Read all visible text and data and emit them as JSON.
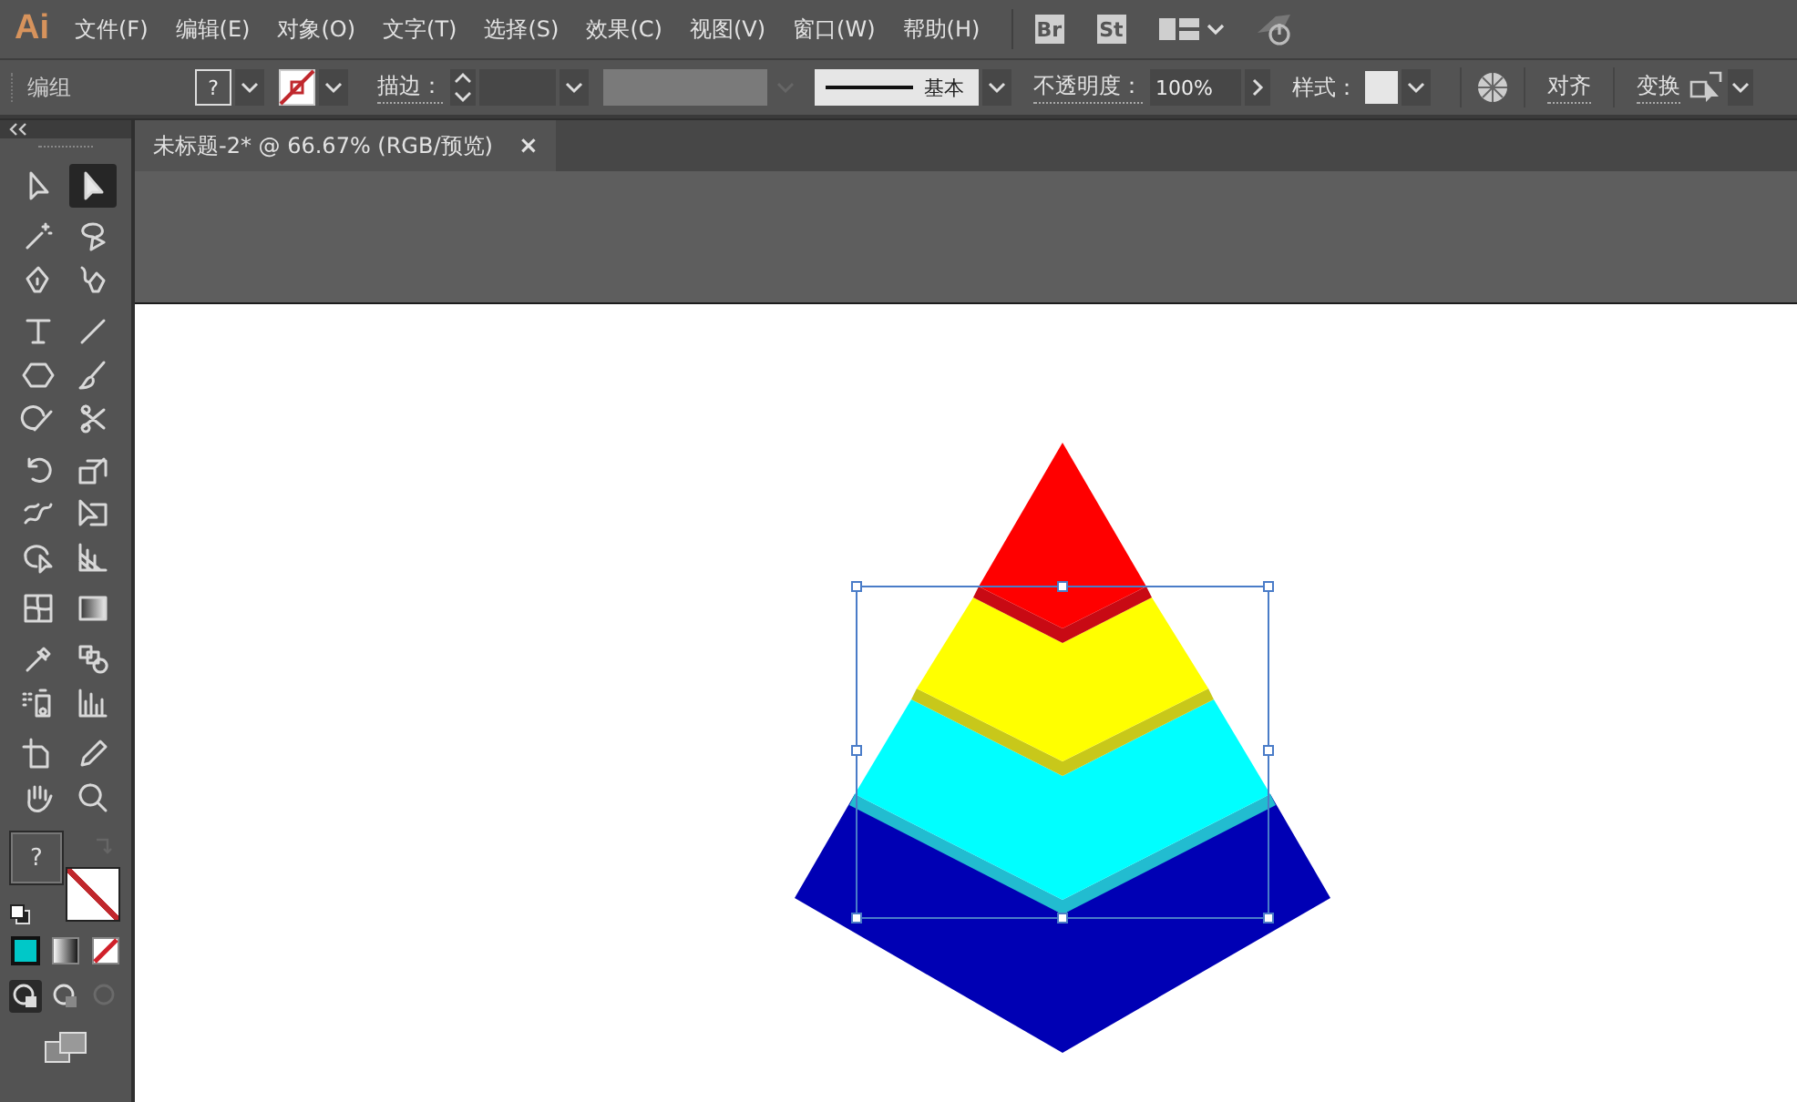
{
  "app": {
    "logo": "Ai",
    "menus": [
      "文件(F)",
      "编辑(E)",
      "对象(O)",
      "文字(T)",
      "选择(S)",
      "效果(C)",
      "视图(V)",
      "窗口(W)",
      "帮助(H)"
    ],
    "bridge_button": "Br",
    "stock_button": "St"
  },
  "control_bar": {
    "selection_label": "编组",
    "fill_swatch": "?",
    "stroke_label": "描边：",
    "brush": "基本",
    "opacity_label": "不透明度：",
    "opacity": "100%",
    "style_label": "样式：",
    "align_link": "对齐",
    "transform_link": "变换"
  },
  "document_tab": {
    "title": "未标题-2* @ 66.67% (RGB/预览)",
    "close": "×"
  },
  "tools": [
    {
      "kind": "select",
      "selected": false
    },
    {
      "kind": "direct-select",
      "selected": true
    },
    {
      "kind": "wand",
      "selected": false
    },
    {
      "kind": "lasso",
      "selected": false
    },
    {
      "kind": "pen",
      "selected": false
    },
    {
      "kind": "curvature",
      "selected": false
    },
    {
      "kind": "type",
      "selected": false
    },
    {
      "kind": "line",
      "selected": false
    },
    {
      "kind": "hexagon",
      "selected": false
    },
    {
      "kind": "brush",
      "selected": false
    },
    {
      "kind": "shaper",
      "selected": false
    },
    {
      "kind": "scissors",
      "selected": false
    },
    {
      "kind": "rotate",
      "selected": false
    },
    {
      "kind": "scale",
      "selected": false
    },
    {
      "kind": "warp",
      "selected": false
    },
    {
      "kind": "free-transform",
      "selected": false
    },
    {
      "kind": "shape-builder",
      "selected": false
    },
    {
      "kind": "perspective",
      "selected": false
    },
    {
      "kind": "mesh",
      "selected": false
    },
    {
      "kind": "gradient",
      "selected": false
    },
    {
      "kind": "eyedropper",
      "selected": false
    },
    {
      "kind": "blend",
      "selected": false
    },
    {
      "kind": "sprayer",
      "selected": false
    },
    {
      "kind": "graph",
      "selected": false
    },
    {
      "kind": "artboard",
      "selected": false
    },
    {
      "kind": "pencil",
      "selected": false
    },
    {
      "kind": "hand",
      "selected": false
    },
    {
      "kind": "zoom",
      "selected": false
    }
  ],
  "fill_stroke": {
    "fill_label": "?"
  },
  "color_modes": [
    {
      "kind": "color",
      "selected": true
    },
    {
      "kind": "gradient",
      "selected": false
    },
    {
      "kind": "none",
      "selected": false
    }
  ],
  "draw_modes": [
    {
      "selected": true,
      "disabled": false
    },
    {
      "selected": false,
      "disabled": false
    },
    {
      "selected": false,
      "disabled": true
    }
  ]
}
